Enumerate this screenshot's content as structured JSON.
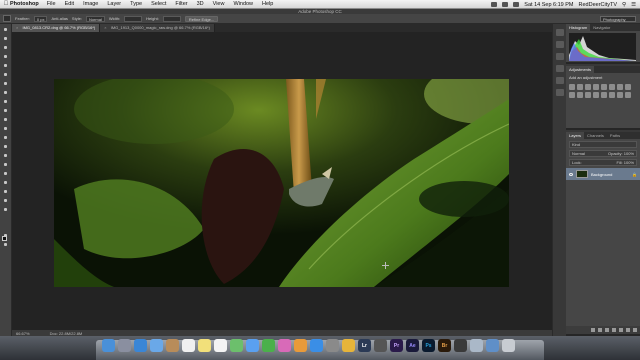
{
  "menubar": {
    "apple": "",
    "app": "Photoshop",
    "menus": [
      "File",
      "Edit",
      "Image",
      "Layer",
      "Type",
      "Select",
      "Filter",
      "3D",
      "View",
      "Window",
      "Help"
    ],
    "clock": "Sat 14 Sep 6:19 PM",
    "user": "RedDeerCityTV"
  },
  "window_title": "Adobe Photoshop CC",
  "options_bar": {
    "feather_label": "Feather:",
    "feather_value": "0 px",
    "antialias_label": "Anti-alias",
    "style_label": "Style:",
    "style_value": "Normal",
    "width_label": "Width:",
    "height_label": "Height:",
    "refine_edge": "Refine Edge...",
    "workspace": "Photography"
  },
  "tabs": [
    {
      "label": "IMG_0813.CR2.dng @ 66.7% (RGB/16*)",
      "active": true
    },
    {
      "label": "IMG_1913_Q0000_magic_raw.dng @ 66.7% (RGB/16*)",
      "active": false
    }
  ],
  "status": {
    "zoom": "66.67%",
    "doc": "Doc: 22.8M/22.8M"
  },
  "panels": {
    "histogram_tabs": [
      "Histogram",
      "Navigator"
    ],
    "adjustments_tab": "Adjustments",
    "adjustments_label": "Add an adjustment",
    "layers_tabs": [
      "Layers",
      "Channels",
      "Paths"
    ],
    "kind_label": "Kind",
    "blend_mode": "Normal",
    "opacity": "Opacity: 100%",
    "lock": "Lock:",
    "fill": "Fill: 100%",
    "layer_name": "Background"
  },
  "dock": {
    "apps": [
      "Finder",
      "Launchpad",
      "Safari",
      "Mail",
      "Contacts",
      "Calendar",
      "Notes",
      "Reminders",
      "Maps",
      "Messages",
      "FaceTime",
      "iTunes",
      "iBooks",
      "App Store",
      "System Preferences",
      "Chrome",
      "Lightroom",
      "Aperture",
      "Premiere",
      "After Effects",
      "Photoshop",
      "Bridge",
      "Media Encoder",
      "Preview",
      "Downloads",
      "Trash"
    ],
    "labels": {
      "aftereffects": "Ae",
      "photoshop": "Ps",
      "premiere": "Pr",
      "bridge": "Br",
      "lightroom": "Lr"
    }
  },
  "colors": {
    "ps_dark": "#2a2a2a",
    "ps_panel": "#464646",
    "layer_selected": "#6a7a8e",
    "photoshop_blue": "#26a0da",
    "aftereffects_purple": "#9a8cff",
    "premiere_purple": "#7a6dd8"
  }
}
